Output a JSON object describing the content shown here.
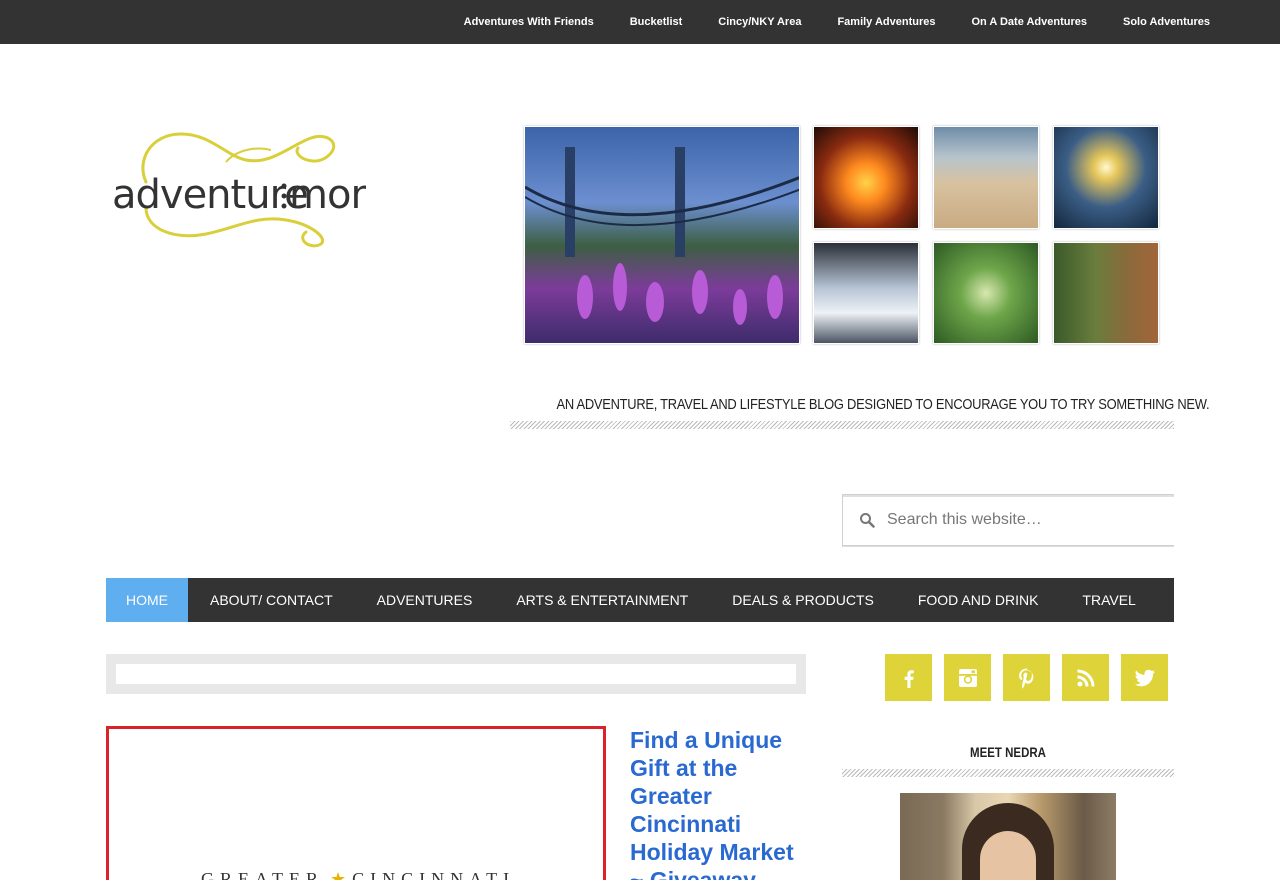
{
  "top_nav": {
    "items": [
      "Adventures With Friends",
      "Bucketlist",
      "Cincy/NKY Area",
      "Family Adventures",
      "On A Date Adventures",
      "Solo Adventures"
    ]
  },
  "header": {
    "logo_text": "adventure mom",
    "tagline": "An Adventure, Travel and Lifestyle Blog Designed to Encourage You to Try Something New."
  },
  "search": {
    "placeholder": "Search this website…",
    "value": ""
  },
  "main_nav": {
    "items": [
      {
        "label": "HOME",
        "active": true
      },
      {
        "label": "ABOUT/ CONTACT",
        "active": false
      },
      {
        "label": "ADVENTURES",
        "active": false
      },
      {
        "label": "ARTS & ENTERTAINMENT",
        "active": false
      },
      {
        "label": "DEALS & PRODUCTS",
        "active": false
      },
      {
        "label": "FOOD AND DRINK",
        "active": false
      },
      {
        "label": "TRAVEL",
        "active": false
      }
    ]
  },
  "post": {
    "title": "Find a Unique Gift at the Greater Cincinnati Holiday Market ~ Giveaway",
    "image_text_left": "GREATER",
    "image_text_right": "CINCINNATI"
  },
  "sidebar": {
    "social": [
      "facebook-icon",
      "instagram-icon",
      "pinterest-icon",
      "rss-icon",
      "twitter-icon"
    ],
    "widget_title": "MEET NEDRA"
  },
  "colors": {
    "topbar": "#333333",
    "nav_active": "#5faef0",
    "social_bg": "#ded43a",
    "post_title": "#2a6ad0",
    "logo": "#d8cf3a",
    "post_image_border": "#d8232a"
  }
}
